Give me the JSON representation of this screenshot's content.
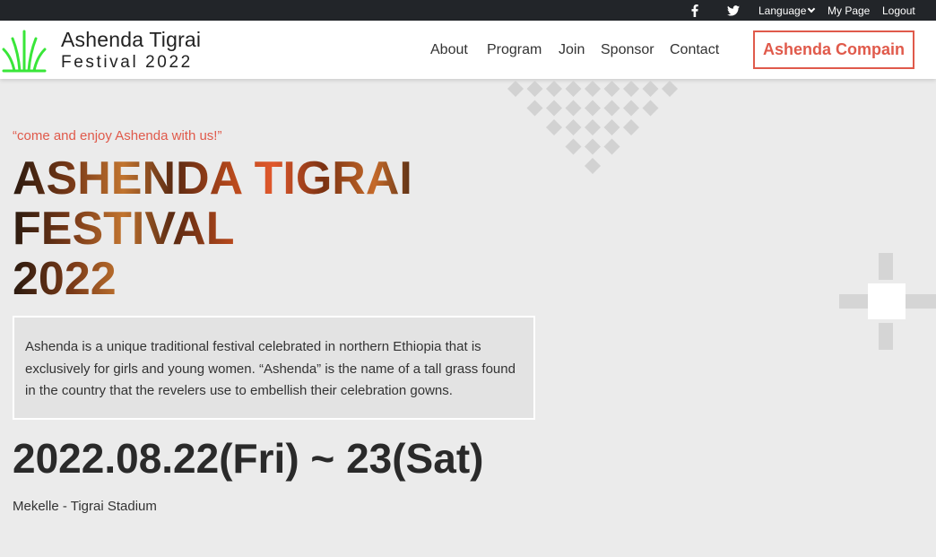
{
  "topbar": {
    "facebook_icon": "facebook-icon",
    "twitter_icon": "twitter-icon",
    "language_label": "Language",
    "my_page_label": "My Page",
    "logout_label": "Logout"
  },
  "header": {
    "brand_title": "Ashenda Tigrai",
    "brand_subtitle": "Festival 2022",
    "logo_icon": "grass-logo-icon",
    "nav": [
      "About",
      "Program",
      "Join",
      "Sponsor",
      "Contact"
    ],
    "cta_label": "Ashenda Compain"
  },
  "hero": {
    "tagline": "“come and enjoy Ashenda with us!”",
    "title_line1": "ASHENDA TIGRAI",
    "title_line2": "FESTIVAL",
    "title_line3": "2022",
    "description": "Ashenda is a unique traditional festival celebrated in northern Ethiopia that is exclusively for girls and young women. “Ashenda” is the name of a tall grass found in the country that the revelers use to embellish their celebration gowns.",
    "date": "2022.08.22(Fri) ~ 23(Sat)",
    "venue": "Mekelle - Tigrai Stadium"
  },
  "colors": {
    "accent": "#e05a4b",
    "logo_green": "#39e639",
    "topbar_bg": "#222529",
    "page_bg": "#ebebeb"
  }
}
